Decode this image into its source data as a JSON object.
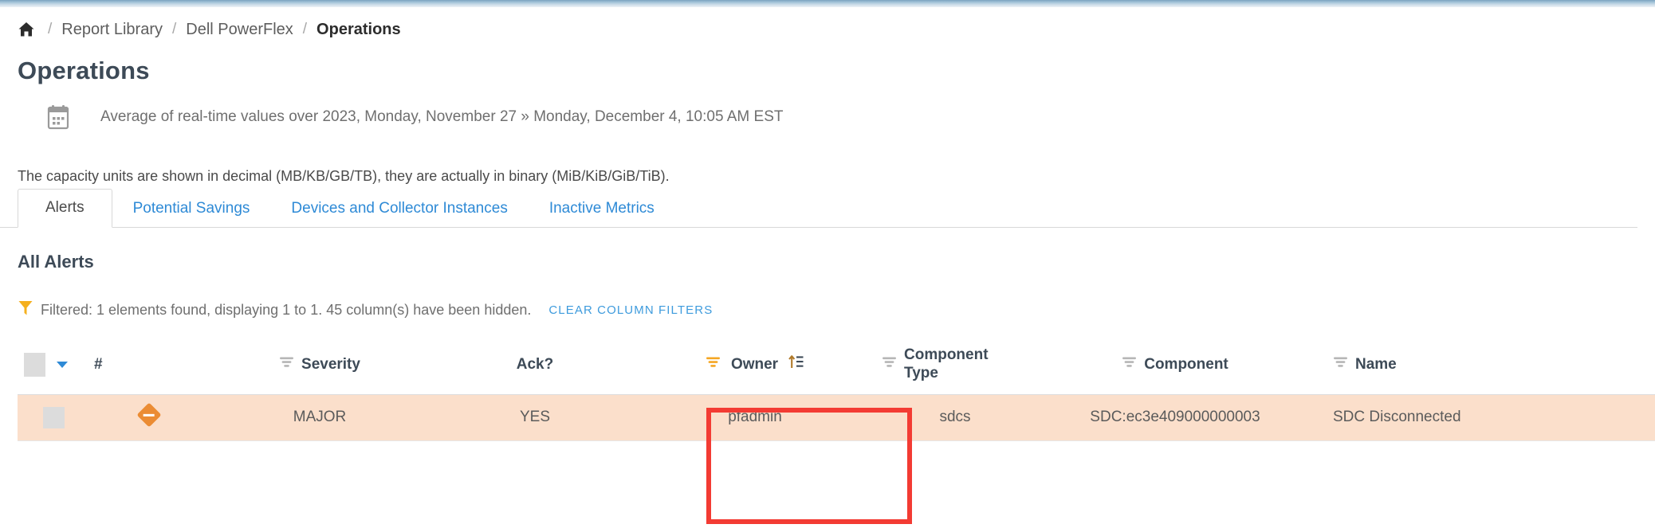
{
  "breadcrumb": {
    "home_icon": "home-icon",
    "separator": "/",
    "items": [
      {
        "label": "Report Library",
        "current": false
      },
      {
        "label": "Dell PowerFlex",
        "current": false
      },
      {
        "label": "Operations",
        "current": true
      }
    ]
  },
  "header": {
    "title": "Operations",
    "calendar_icon": "calendar-icon",
    "date_range": "Average of real-time values over 2023, Monday, November 27 » Monday, December 4, 10:05 AM EST"
  },
  "notes": {
    "capacity_units": "The capacity units are shown in decimal (MB/KB/GB/TB), they are actually in binary (MiB/KiB/GiB/TiB)."
  },
  "tabs": [
    {
      "label": "Alerts",
      "active": true
    },
    {
      "label": "Potential Savings",
      "active": false
    },
    {
      "label": "Devices and Collector Instances",
      "active": false
    },
    {
      "label": "Inactive Metrics",
      "active": false
    }
  ],
  "section": {
    "title": "All Alerts"
  },
  "filter_bar": {
    "funnel_icon": "funnel-icon",
    "text": "Filtered: 1 elements found, displaying 1 to 1. 45 column(s) have been hidden.",
    "clear_label": "CLEAR COLUMN FILTERS"
  },
  "table": {
    "columns": [
      {
        "label": "",
        "filter_icon": false,
        "sort_icon": false,
        "checkbox": true
      },
      {
        "label": "#",
        "filter_icon": false,
        "sort_icon": false
      },
      {
        "label": "Severity",
        "filter_icon": true,
        "filter_active": false,
        "sort_icon": false
      },
      {
        "label": "Ack?",
        "filter_icon": false,
        "sort_icon": false
      },
      {
        "label": "Owner",
        "filter_icon": true,
        "filter_active": true,
        "sort_icon": true
      },
      {
        "label": "Component Type",
        "filter_icon": true,
        "filter_active": false,
        "sort_icon": false
      },
      {
        "label": "Component",
        "filter_icon": true,
        "filter_active": false,
        "sort_icon": false
      },
      {
        "label": "Name",
        "filter_icon": true,
        "filter_active": false,
        "sort_icon": false
      }
    ],
    "rows": [
      {
        "select": "",
        "num": "severity-diamond-icon",
        "severity": "MAJOR",
        "ack": "YES",
        "owner": "pfadmin",
        "component_type": "sdcs",
        "component": "SDC:ec3e409000000003",
        "name": "SDC Disconnected"
      }
    ]
  },
  "colors": {
    "accent_blue": "#2e8ad6",
    "row_highlight": "#fbdfcb",
    "severity_orange": "#eb8c34",
    "annotation_red": "#f33b33",
    "filter_active_orange": "#f5a623",
    "heading_slate": "#3d4a57"
  },
  "annotation": {
    "type": "highlight-box",
    "target": "owner-column"
  }
}
